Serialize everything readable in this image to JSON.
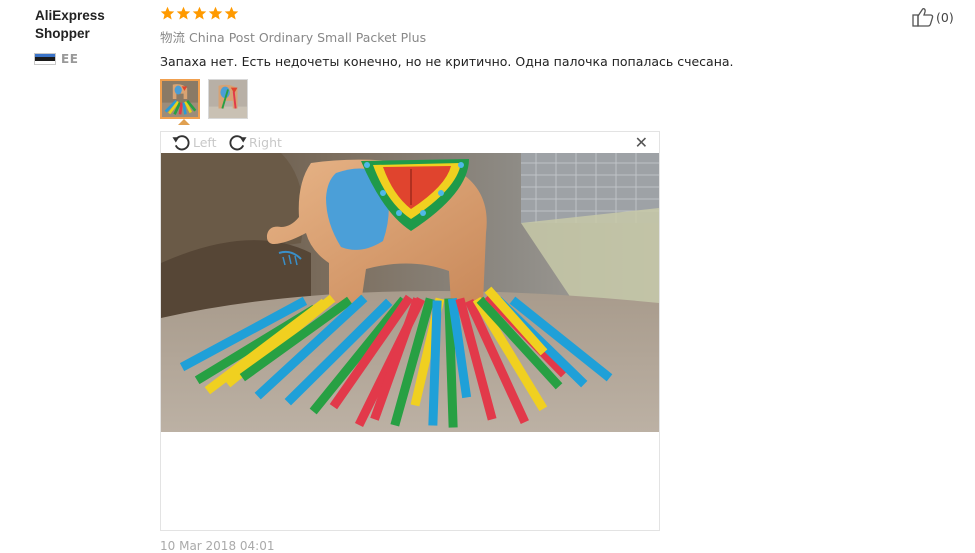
{
  "user": {
    "name": "AliExpress Shopper",
    "country_code": "EE",
    "flag_colors": [
      "#3a73c7",
      "#1a1a1a",
      "#ffffff"
    ]
  },
  "review": {
    "rating": 5,
    "star_color": "#ff9a00",
    "shipping_label": "物流",
    "shipping_method": "China Post Ordinary Small Packet Plus",
    "comment": "Запаха нет. Есть недочеты конечно, но не критично. Одна палочка попалась счесана.",
    "date": "10 Mar 2018 04:01"
  },
  "thumbnails": [
    {
      "name": "photo-1",
      "active": true
    },
    {
      "name": "photo-2",
      "active": false
    }
  ],
  "viewer": {
    "rotate_left_label": "Left",
    "rotate_right_label": "Right",
    "close_icon": "close-icon"
  },
  "helpful": {
    "count_text": "(0)",
    "icon": "thumbs-up-icon"
  }
}
